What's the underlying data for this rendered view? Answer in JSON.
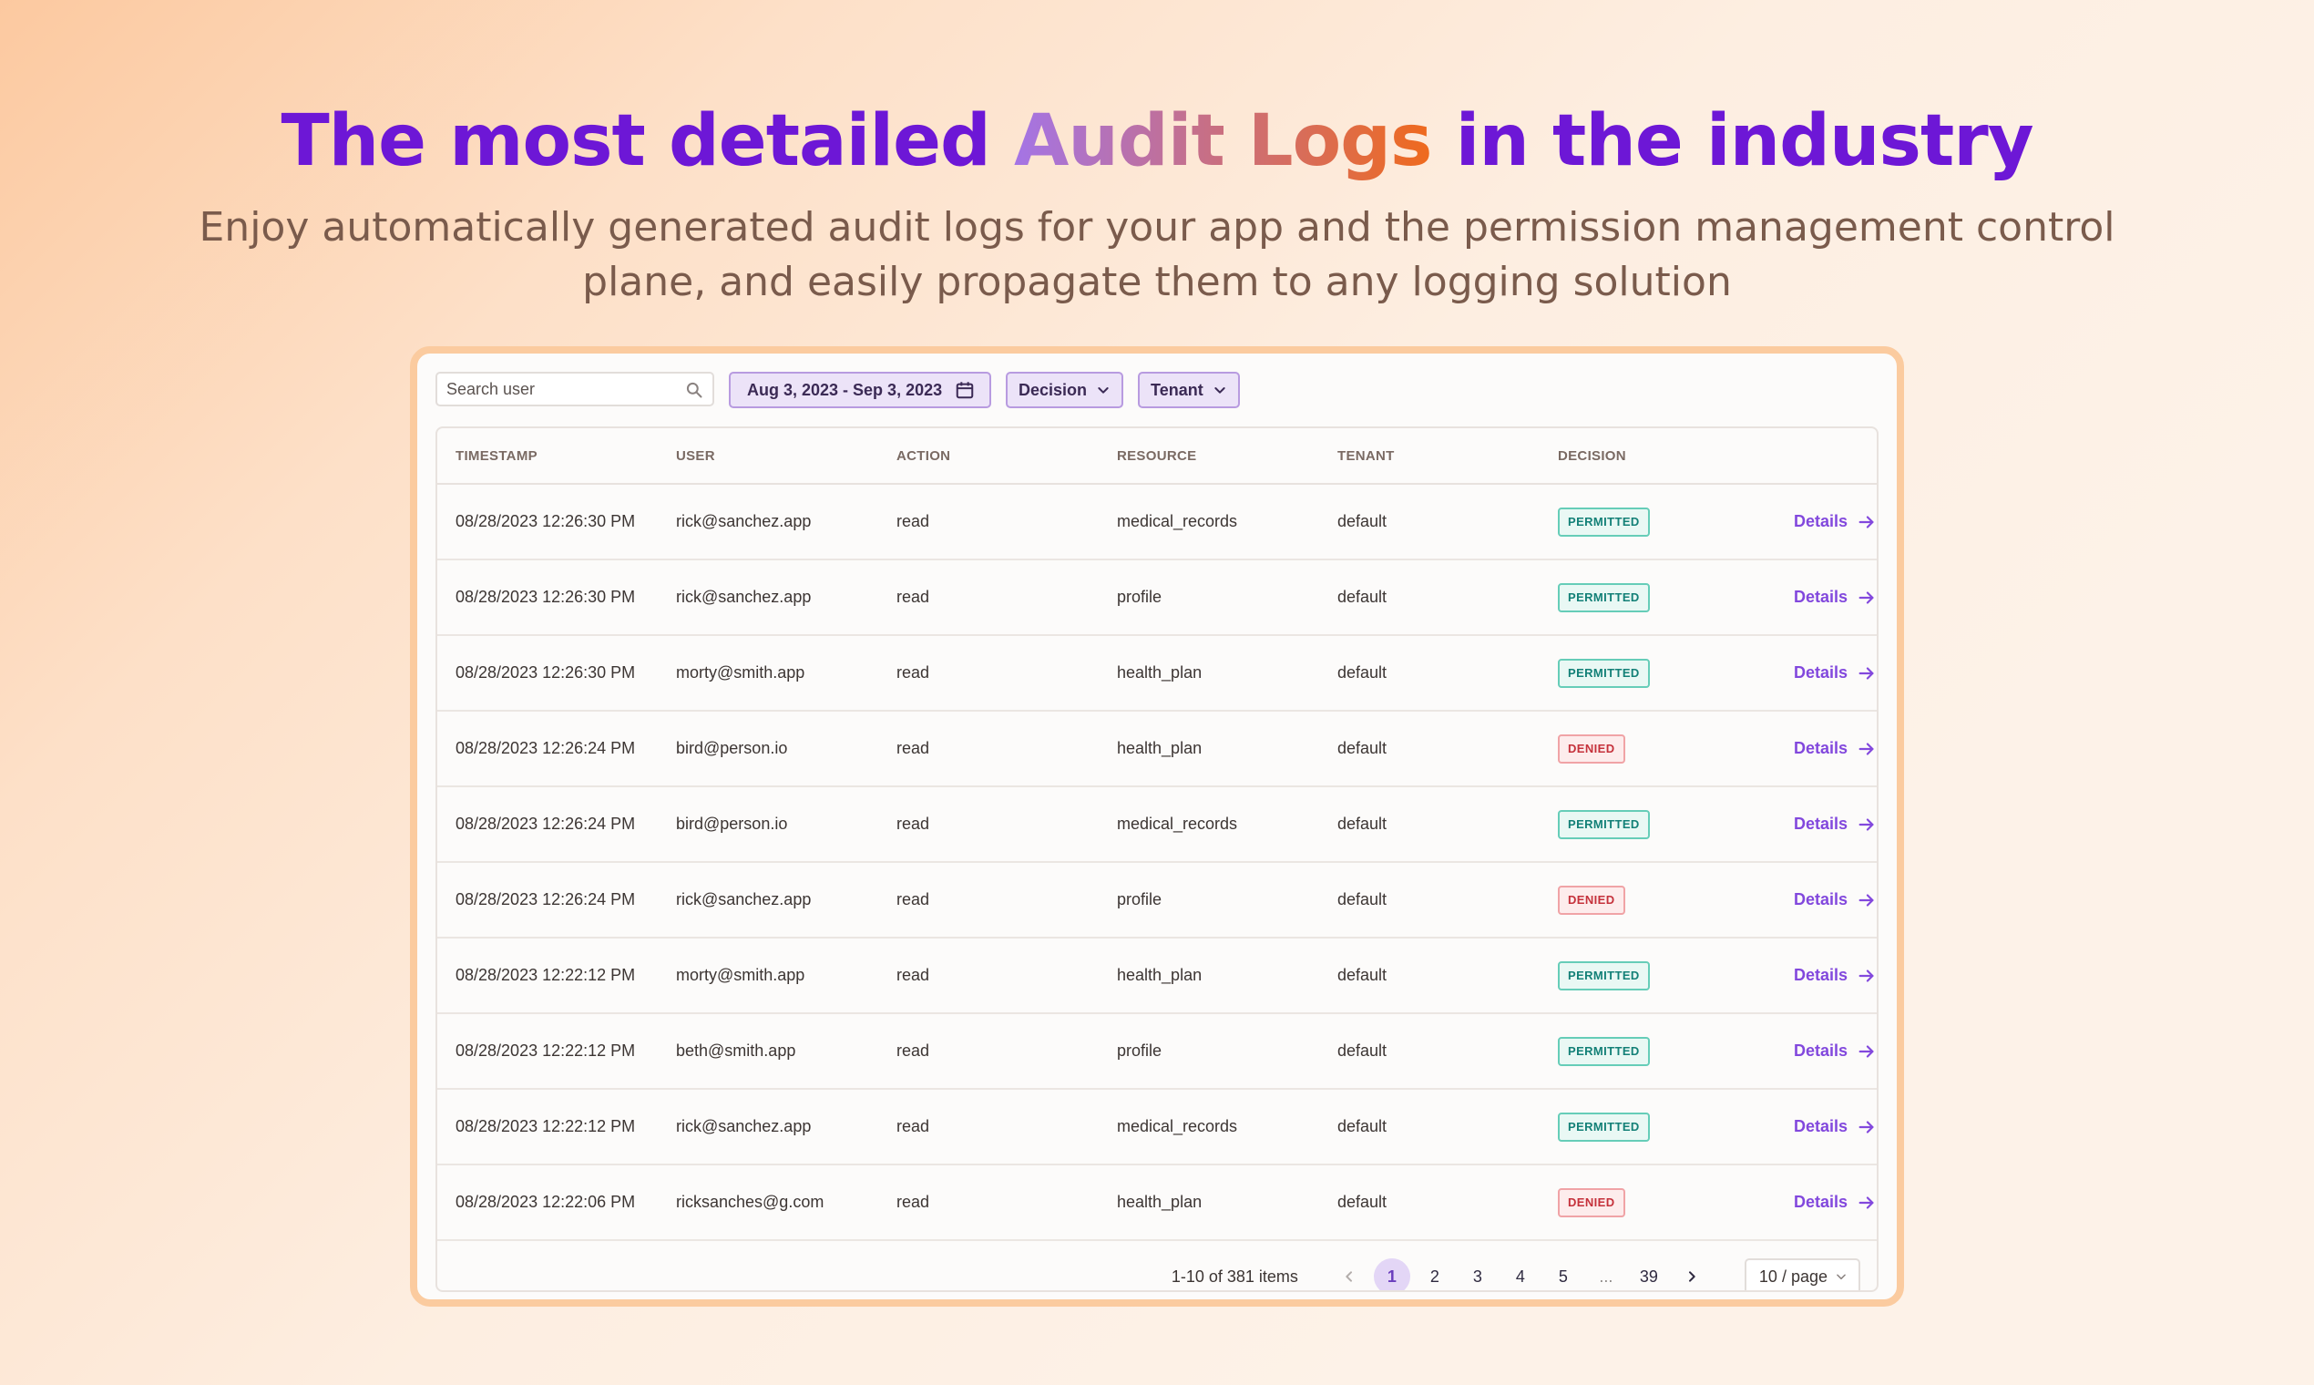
{
  "hero": {
    "title_pre": "The most detailed ",
    "title_highlight": "Audit Logs",
    "title_post": " in the industry",
    "subtitle": "Enjoy automatically generated audit logs for your app and the permission management control plane, and easily propagate them to any logging solution"
  },
  "toolbar": {
    "search_placeholder": "Search user",
    "date_range": "Aug 3, 2023 - Sep 3, 2023",
    "decision_filter": "Decision",
    "tenant_filter": "Tenant"
  },
  "table": {
    "headers": [
      "TIMESTAMP",
      "USER",
      "ACTION",
      "RESOURCE",
      "TENANT",
      "DECISION"
    ],
    "details_label": "Details",
    "rows": [
      {
        "timestamp": "08/28/2023 12:26:30 PM",
        "user": "rick@sanchez.app",
        "action": "read",
        "resource": "medical_records",
        "tenant": "default",
        "decision": "PERMITTED"
      },
      {
        "timestamp": "08/28/2023 12:26:30 PM",
        "user": "rick@sanchez.app",
        "action": "read",
        "resource": "profile",
        "tenant": "default",
        "decision": "PERMITTED"
      },
      {
        "timestamp": "08/28/2023 12:26:30 PM",
        "user": "morty@smith.app",
        "action": "read",
        "resource": "health_plan",
        "tenant": "default",
        "decision": "PERMITTED"
      },
      {
        "timestamp": "08/28/2023 12:26:24 PM",
        "user": "bird@person.io",
        "action": "read",
        "resource": "health_plan",
        "tenant": "default",
        "decision": "DENIED"
      },
      {
        "timestamp": "08/28/2023 12:26:24 PM",
        "user": "bird@person.io",
        "action": "read",
        "resource": "medical_records",
        "tenant": "default",
        "decision": "PERMITTED"
      },
      {
        "timestamp": "08/28/2023 12:26:24 PM",
        "user": "rick@sanchez.app",
        "action": "read",
        "resource": "profile",
        "tenant": "default",
        "decision": "DENIED"
      },
      {
        "timestamp": "08/28/2023 12:22:12 PM",
        "user": "morty@smith.app",
        "action": "read",
        "resource": "health_plan",
        "tenant": "default",
        "decision": "PERMITTED"
      },
      {
        "timestamp": "08/28/2023 12:22:12 PM",
        "user": "beth@smith.app",
        "action": "read",
        "resource": "profile",
        "tenant": "default",
        "decision": "PERMITTED"
      },
      {
        "timestamp": "08/28/2023 12:22:12 PM",
        "user": "rick@sanchez.app",
        "action": "read",
        "resource": "medical_records",
        "tenant": "default",
        "decision": "PERMITTED"
      },
      {
        "timestamp": "08/28/2023 12:22:06 PM",
        "user": "ricksanches@g.com",
        "action": "read",
        "resource": "health_plan",
        "tenant": "default",
        "decision": "DENIED"
      }
    ]
  },
  "pagination": {
    "range_text": "1-10 of 381 items",
    "pages": [
      "1",
      "2",
      "3",
      "4",
      "5",
      "...",
      "39"
    ],
    "current_page": "1",
    "page_size": "10 / page"
  },
  "colors": {
    "accent": "#8248dd",
    "title": "#6d17d6",
    "permitted": "#138077",
    "denied": "#c5313b",
    "frame": "#fbcb9f"
  },
  "icons": [
    "search-icon",
    "calendar-icon",
    "chevron-down-icon",
    "arrow-right-icon",
    "chevron-left-icon",
    "chevron-right-icon"
  ]
}
